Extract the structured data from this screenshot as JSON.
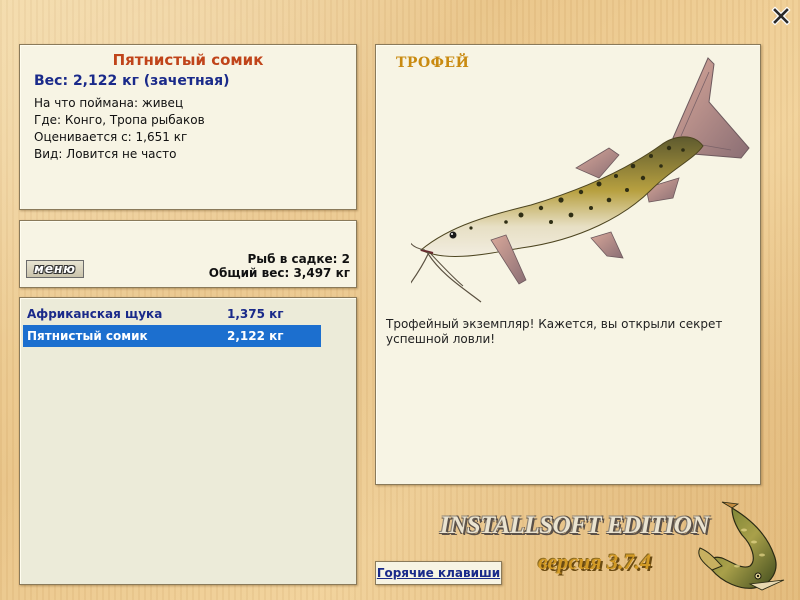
{
  "fish_info": {
    "title": "Пятнистый сомик",
    "weight": "Вес: 2,122 кг (зачетная)",
    "caught_on": "На что поймана: живец",
    "location": "Где: Конго, Тропа рыбаков",
    "valued_from": "Оценивается с: 1,651 кг",
    "kind": "Вид: Ловится не часто"
  },
  "cage": {
    "menu_label": "меню",
    "fish_count": "Рыб в садке: 2",
    "total_weight": "Общий вес: 3,497 кг"
  },
  "catch_list": [
    {
      "name": "Африканская щука",
      "weight": "1,375 кг",
      "selected": false
    },
    {
      "name": "Пятнистый сомик",
      "weight": "2,122 кг",
      "selected": true
    }
  ],
  "trophy": {
    "title": "ТРОФЕЙ",
    "text": "Трофейный экземпляр! Кажется, вы открыли секрет успешной ловли!"
  },
  "footer": {
    "hotkeys_label": "Горячие клавиши",
    "brand": "INSTALLSOFT EDITION",
    "version": "версия 3.7.4"
  },
  "icons": {
    "close": "close-icon",
    "logo": "pike-logo-icon",
    "fish": "catfish-image"
  },
  "colors": {
    "title_orange": "#c0441a",
    "text_blue": "#1a2a8a",
    "selection_blue": "#1c6fcf",
    "trophy_gold": "#c98a10"
  }
}
